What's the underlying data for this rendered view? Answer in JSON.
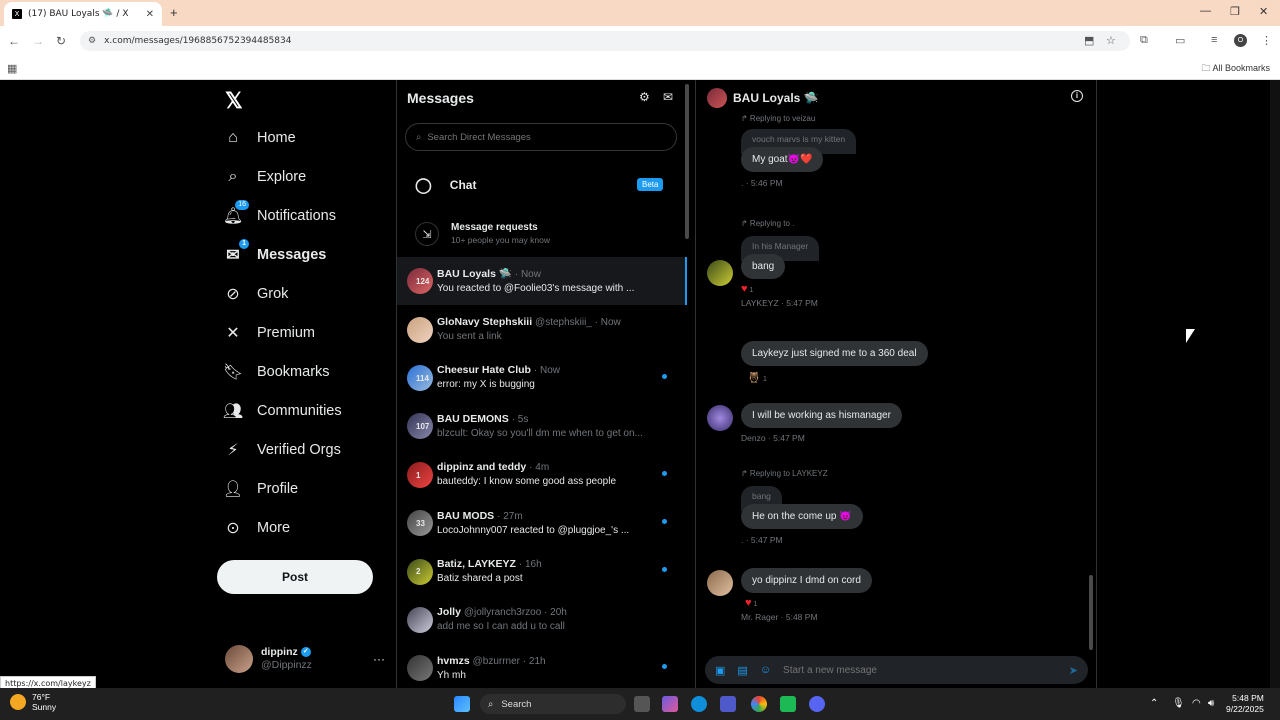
{
  "browser": {
    "tab_title": "(17) BAU Loyals 🛸 / X",
    "url": "x.com/messages/1968856752394485834",
    "all_bookmarks": "All Bookmarks",
    "status_link": "https://x.com/laykeyz"
  },
  "nav": {
    "items": [
      {
        "label": "Home",
        "icon": "home-icon"
      },
      {
        "label": "Explore",
        "icon": "search-icon"
      },
      {
        "label": "Notifications",
        "icon": "bell-icon",
        "badge": "16"
      },
      {
        "label": "Messages",
        "icon": "mail-icon",
        "badge": "1"
      },
      {
        "label": "Grok",
        "icon": "grok-icon"
      },
      {
        "label": "Premium",
        "icon": "x-icon"
      },
      {
        "label": "Bookmarks",
        "icon": "bookmark-icon"
      },
      {
        "label": "Communities",
        "icon": "people-icon"
      },
      {
        "label": "Verified Orgs",
        "icon": "lightning-icon"
      },
      {
        "label": "Profile",
        "icon": "person-icon"
      },
      {
        "label": "More",
        "icon": "more-circle-icon"
      }
    ],
    "post_label": "Post",
    "account": {
      "name": "dippinz",
      "handle": "@Dippinzz"
    }
  },
  "messages": {
    "title": "Messages",
    "search_placeholder": "Search Direct Messages",
    "chat_label": "Chat",
    "beta_label": "Beta",
    "requests_title": "Message requests",
    "requests_sub": "10+ people you may know",
    "conversations": [
      {
        "name": "BAU Loyals 🛸",
        "meta": "· Now",
        "preview": "You reacted to @Foolie03's message with ...",
        "count": "124",
        "muted": false,
        "unread": false,
        "selected": true,
        "c1": "#7a2a3a",
        "c2": "#d66"
      },
      {
        "name": "GloNavy Stephskiii",
        "meta": "@stephskiii_ · Now",
        "preview": "You sent a link",
        "count": "",
        "muted": true,
        "unread": false,
        "selected": false,
        "c1": "#c9a27e",
        "c2": "#f0d2c0"
      },
      {
        "name": "Cheesur Hate Club",
        "meta": "· Now",
        "preview": "error: my X is bugging",
        "count": "114",
        "muted": false,
        "unread": true,
        "selected": false,
        "c1": "#2a6fd6",
        "c2": "#9bd"
      },
      {
        "name": "BAU DEMONS",
        "meta": "· 5s",
        "preview": "blzcult: Okay so you'll dm me when to get on...",
        "count": "107",
        "muted": true,
        "unread": false,
        "selected": false,
        "c1": "#335",
        "c2": "#88a"
      },
      {
        "name": "dippinz and teddy",
        "meta": "· 4m",
        "preview": "bauteddy: I know some good ass people",
        "count": "1",
        "muted": false,
        "unread": true,
        "selected": false,
        "c1": "#8a1a1a",
        "c2": "#e44"
      },
      {
        "name": "BAU MODS",
        "meta": "· 27m",
        "preview": "LocoJohnny007 reacted to @pluggjoe_'s ...",
        "count": "33",
        "muted": false,
        "unread": true,
        "selected": false,
        "c1": "#444",
        "c2": "#999"
      },
      {
        "name": "Batiz, LAYKEYZ",
        "meta": "· 16h",
        "preview": "Batiz shared a post",
        "count": "2",
        "muted": false,
        "unread": true,
        "selected": false,
        "c1": "#3a4a1a",
        "c2": "#cc3"
      },
      {
        "name": "Jolly",
        "meta": "@jollyranch3rzoo · 20h",
        "preview": "add me so I can add u to call",
        "count": "",
        "muted": true,
        "unread": false,
        "selected": false,
        "c1": "#445",
        "c2": "#ccd"
      },
      {
        "name": "hvmzs",
        "meta": "@bzurrner · 21h",
        "preview": "Yh mh",
        "count": "",
        "muted": false,
        "unread": true,
        "selected": false,
        "c1": "#333",
        "c2": "#777"
      }
    ]
  },
  "chat": {
    "title": "BAU Loyals 🛸",
    "messages": {
      "m1_reply": "↱ Replying to veizau",
      "m1_quote": "vouch marvs is my kitten",
      "m1_text": "My goat😈❤️",
      "m1_stamp": ". · 5:46 PM",
      "m2_reply": "↱ Replying to .",
      "m2_quote": "In his Manager",
      "m2_text": "bang",
      "m2_react": "1",
      "m2_stamp": "LAYKEYZ · 5:47 PM",
      "m3_text": "Laykeyz just signed me to a 360 deal",
      "m3_react": "1",
      "m4_text": "I will be working as hismanager",
      "m4_stamp": "Denzo · 5:47 PM",
      "m5_reply": "↱ Replying to LAYKEYZ",
      "m5_quote": "bang",
      "m5_text": "He on the come up 😈",
      "m5_stamp": ". · 5:47 PM",
      "m6_text": "yo dippinz I dmd on cord",
      "m6_react": "1",
      "m6_stamp": "Mr. Rager · 5:48 PM"
    },
    "composer_placeholder": "Start a new message"
  },
  "taskbar": {
    "temp": "76°F",
    "weather": "Sunny",
    "search": "Search",
    "time": "5:48 PM",
    "date": "9/22/2025"
  }
}
